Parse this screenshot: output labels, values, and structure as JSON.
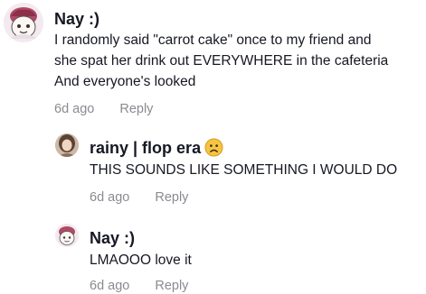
{
  "comments": [
    {
      "username": "Nay :)",
      "text": "I randomly said \"carrot cake\" once to my friend and\nshe spat her drink out EVERYWHERE in the cafeteria\nAnd everyone's looked",
      "time": "6d ago",
      "reply_label": "Reply",
      "avatar": "cartoon-character-avatar"
    },
    {
      "username": "rainy | flop era",
      "emoji": "worried-face-emoji",
      "text": "THIS SOUNDS LIKE SOMETHING I WOULD DO",
      "time": "6d ago",
      "reply_label": "Reply",
      "avatar": "photo-avatar"
    },
    {
      "username": "Nay :)",
      "text": "LMAOOO love it",
      "time": "6d ago",
      "reply_label": "Reply",
      "avatar": "cartoon-character-avatar"
    }
  ],
  "colors": {
    "username": "#161823",
    "text": "#161823",
    "meta": "#8a8b91",
    "emoji": "#f5c542"
  }
}
